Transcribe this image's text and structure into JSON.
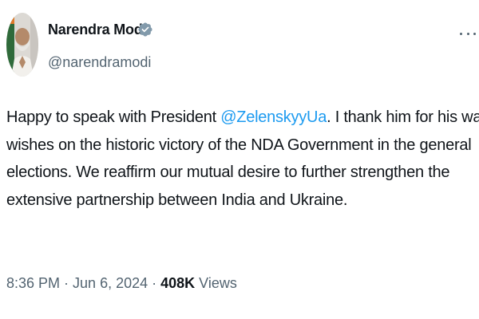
{
  "author": {
    "name": "Narendra Modi",
    "handle": "@narendramodi",
    "verified": true
  },
  "tweet": {
    "text_prefix": "Happy to speak with President ",
    "mention": "@ZelenskyyUa",
    "text_suffix": ". I thank him for his warm",
    "line2": "wishes on the historic victory of the NDA Government in the general",
    "line3": "elections. We reaffirm our mutual desire to further strengthen the",
    "line4": "extensive partnership between India and Ukraine."
  },
  "meta": {
    "time": "8:36 PM",
    "separator": " · ",
    "date": "Jun 6, 2024",
    "views_count": "408K",
    "views_label": " Views"
  },
  "icons": {
    "avatar": "avatar-photo",
    "verified": "verified-badge-icon",
    "more": "more-dots-icon"
  },
  "colors": {
    "mention": "#1d9bf0",
    "secondary_text": "#536471",
    "verified_badge": "#829aab"
  }
}
